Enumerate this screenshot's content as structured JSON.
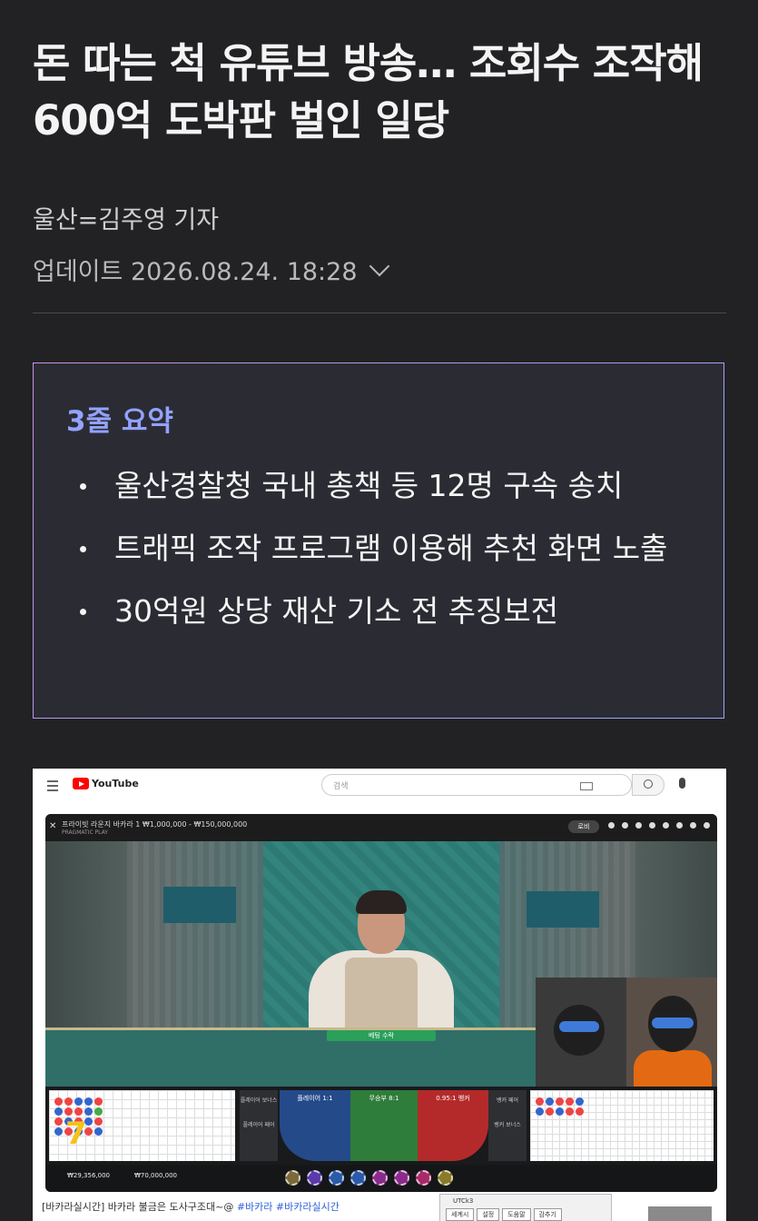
{
  "article": {
    "headline": "돈 따는 척 유튜브 방송… 조회수 조작해 600억 도박판 벌인 일당",
    "byline": "울산=김주영 기자",
    "updated": "업데이트 2026.08.24. 18:28"
  },
  "summary": {
    "title": "3줄 요약",
    "items": [
      {
        "text": "울산경찰청 국내 총책 등 12명 구속 송치"
      },
      {
        "text": "트래픽 조작 프로그램 이용해 추천 화면 노출"
      },
      {
        "text": "30억원 상당 재산 기소 전 추징보전"
      }
    ]
  },
  "video": {
    "logo": "YouTube",
    "search_placeholder": "검색",
    "player_title": "프라이빗 라운지 바카라 1 ₩1,000,000 - ₩150,000,000",
    "player_sub": "PRAGMATIC PLAY",
    "chip_label": "로비",
    "bet_button": "베팅 수락",
    "player_label": "플레이어 1:1",
    "tie_label": "무승부 8:1",
    "banker_label": "0.95:1 뱅커",
    "player_bonus": "플레이어 보너스",
    "player_pair": "플레이어 페어",
    "banker_pair": "뱅커 페어",
    "banker_bonus": "뱅커 보너스",
    "balance": "₩29,356,000",
    "total_bet": "₩70,000,000",
    "caption_text": "[바카라실시간] 바카라 불금은 도사구조대~@ ",
    "caption_tags": "#바카라 #바카라실시간",
    "utc_title": "UTCk3",
    "utc_buttons": [
      "세계시",
      "설정",
      "도움말",
      "감추기"
    ]
  },
  "colors": {
    "background": "#222224",
    "summary_title": "#93a2ff",
    "summary_border_start": "#c792e8",
    "summary_border_end": "#9aa6ff"
  },
  "icons": {
    "updated_toggle": "chevron-down-icon",
    "search": "search-icon",
    "mic": "mic-icon"
  }
}
